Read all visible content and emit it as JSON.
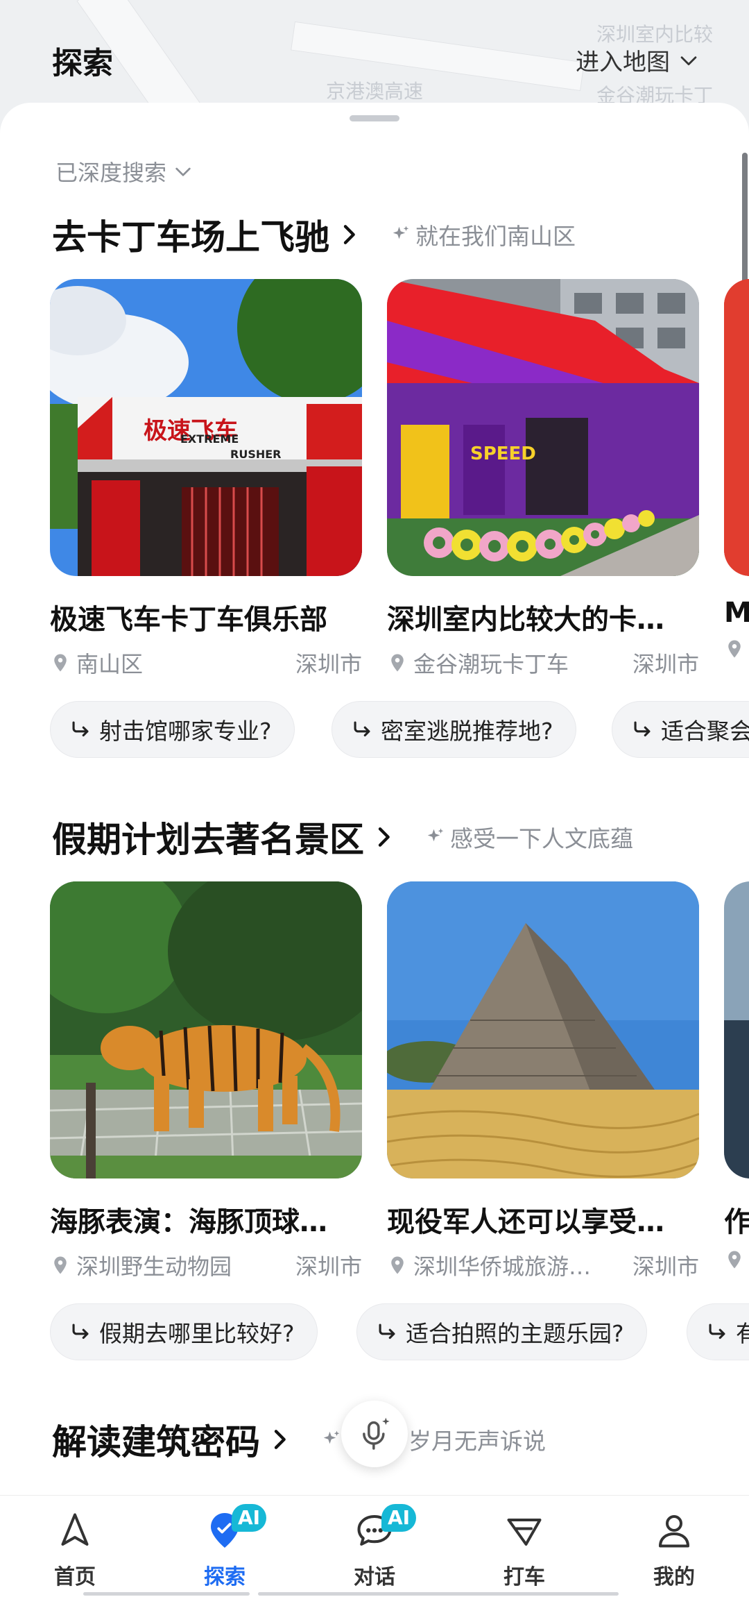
{
  "header": {
    "title": "探索",
    "enter_map": "进入地图",
    "map_labels": [
      "京港澳高速",
      "深圳室内比较",
      "金谷潮玩卡丁"
    ]
  },
  "deep_search": "已深度搜索",
  "sections": [
    {
      "title": "去卡丁车场上飞驰",
      "subtitle": "就在我们南山区",
      "cards": [
        {
          "title": "极速飞车卡丁车俱乐部",
          "location": "南山区",
          "city": "深圳市",
          "sign": "极速飞车",
          "sign_en1": "EXTREME",
          "sign_en2": "RUSHER"
        },
        {
          "title": "深圳室内比较大的卡…",
          "location": "金谷潮玩卡丁车",
          "city": "深圳市",
          "sign": "SPEED"
        },
        {
          "title": "M",
          "location": "",
          "city": ""
        }
      ],
      "chips": [
        "射击馆哪家专业?",
        "密室逃脱推荐地?",
        "适合聚会"
      ]
    },
    {
      "title": "假期计划去著名景区",
      "subtitle": "感受一下人文底蕴",
      "cards": [
        {
          "title": "海豚表演：海豚顶球…",
          "location": "深圳野生动物园",
          "city": "深圳市"
        },
        {
          "title": "现役军人还可以享受…",
          "location": "深圳华侨城旅游…",
          "city": "深圳市"
        },
        {
          "title": "作",
          "location": "",
          "city": ""
        }
      ],
      "chips": [
        "假期去哪里比较好?",
        "适合拍照的主题乐园?",
        "有"
      ]
    },
    {
      "title": "解读建筑密码",
      "subtitle": "岁月无声诉说"
    }
  ],
  "nav": [
    {
      "label": "首页",
      "icon": "navigate-arrow-icon"
    },
    {
      "label": "探索",
      "icon": "explore-pin-icon",
      "badge": "AI",
      "active": true
    },
    {
      "label": "对话",
      "icon": "chat-bubble-icon",
      "badge": "AI"
    },
    {
      "label": "打车",
      "icon": "taxi-icon"
    },
    {
      "label": "我的",
      "icon": "profile-icon"
    }
  ],
  "colors": {
    "accent": "#1e6cf2",
    "ai_badge": "#16b8d6",
    "muted_text": "#8b8f96"
  }
}
